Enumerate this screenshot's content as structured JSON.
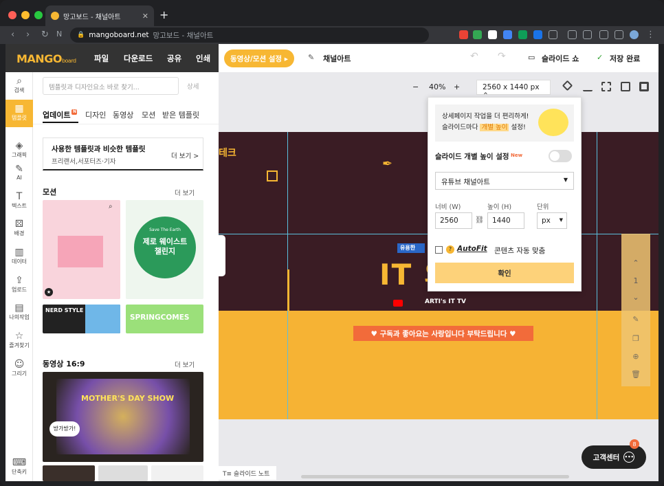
{
  "browser": {
    "tab_title": "망고보드 - 채널아트",
    "url_host": "mangoboard.net",
    "url_rest": "망고보드 - 채널아트"
  },
  "header": {
    "logo_main": "MANGO",
    "logo_sub": "board",
    "menu": [
      "파일",
      "다운로드",
      "공유",
      "인쇄"
    ],
    "motion_button": "동영상/모션 설정 ▸",
    "doc_title": "채널아트",
    "slideshow": "슬라이드 쇼",
    "save_status": "저장 완료"
  },
  "rail": [
    {
      "icon": "search-icon",
      "glyph": "⌕",
      "label": "검색"
    },
    {
      "icon": "template-icon",
      "glyph": "▦",
      "label": "템플릿",
      "active": true
    },
    {
      "icon": "graphic-icon",
      "glyph": "◈",
      "label": "그래픽"
    },
    {
      "icon": "ai-icon",
      "glyph": "✎",
      "label": "AI"
    },
    {
      "icon": "text-icon",
      "glyph": "T",
      "label": "텍스트"
    },
    {
      "icon": "background-icon",
      "glyph": "⚄",
      "label": "배경"
    },
    {
      "icon": "data-icon",
      "glyph": "▥",
      "label": "데이터"
    },
    {
      "icon": "upload-icon",
      "glyph": "⇪",
      "label": "업로드"
    },
    {
      "icon": "mywork-icon",
      "glyph": "▤",
      "label": "나의작업"
    },
    {
      "icon": "star-icon",
      "glyph": "☆",
      "label": "즐겨찾기"
    },
    {
      "icon": "draw-icon",
      "glyph": "☺",
      "label": "그리기"
    },
    {
      "icon": "keyboard-icon",
      "glyph": "⌨",
      "label": "단축키"
    }
  ],
  "panel": {
    "search_placeholder": "템플릿과 디자인요소 바로 찾기...",
    "detail": "상세",
    "tabs": [
      "업데이트",
      "디자인",
      "동영상",
      "모션",
      "받은 템플릿"
    ],
    "reco_title": "사용한 템플릿과 비슷한 템플릿",
    "reco_sub": "프리랜서,서포터즈·기자",
    "reco_more": "더 보기 >",
    "motion_title": "모션",
    "motion_more": "더 보기",
    "video_title": "동영상 16:9",
    "video_more": "더 보기",
    "thumb_texts": {
      "earth": "제로 웨이스트 챌린지",
      "save": "Save The Earth",
      "nerd": "NERD STYLE",
      "spring": "SPRINGCOMES",
      "mothers": "MOTHER'S DAY SHOW",
      "bang": "방가방가!"
    }
  },
  "canvas": {
    "zoom_minus": "−",
    "zoom": "40%",
    "zoom_plus": "+",
    "size": "2560 x 1440 px",
    "banner_text": "IT 의",
    "banner_tag": "유용한",
    "banner_brand": "ARTI's IT TV",
    "banner_corner": "테크",
    "subscribe": "♥ 구독과 좋아요는 사랑입니다 부탁드립니다 ♥",
    "page_number": "1",
    "slide_notes": "슬라이드 노트"
  },
  "popup": {
    "promo_line1": "상세페이지 작업을 더 편리하게!",
    "promo_line2a": "슬라이드마다",
    "promo_highlight": "개별 높이",
    "promo_line2b": "설정!",
    "height_setting": "슬라이드 개별 높이 설정",
    "new_tag": "New",
    "preset": "유튜브 채널아트",
    "width_label": "너비 (W)",
    "height_label": "높이 (H)",
    "unit_label": "단위",
    "width_value": "2560",
    "height_value": "1440",
    "unit_value": "px",
    "autofit_brand": "AutoFit",
    "autofit_text": "콘텐츠 자동 맞춤",
    "confirm": "확인"
  },
  "help": {
    "label": "고객센터",
    "badge": "8"
  }
}
